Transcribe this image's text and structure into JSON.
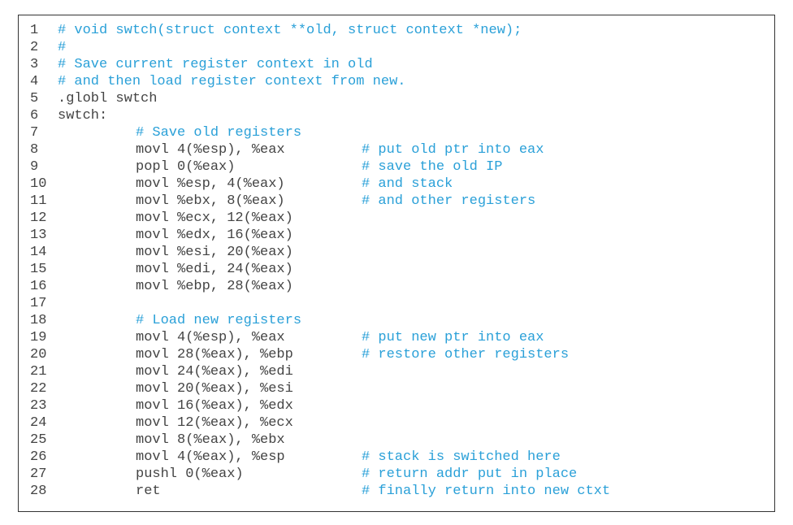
{
  "colors": {
    "comment": "#2aa0d8",
    "text": "#444444",
    "border": "#333333"
  },
  "lines": [
    {
      "n": "1",
      "parts": [
        {
          "cls": "code-comment",
          "t": "# void swtch(struct context **old, struct context *new);"
        }
      ]
    },
    {
      "n": "2",
      "parts": [
        {
          "cls": "code-comment",
          "t": "#"
        }
      ]
    },
    {
      "n": "3",
      "parts": [
        {
          "cls": "code-comment",
          "t": "# Save current register context in old"
        }
      ]
    },
    {
      "n": "4",
      "parts": [
        {
          "cls": "code-comment",
          "t": "# and then load register context from new."
        }
      ]
    },
    {
      "n": "5",
      "parts": [
        {
          "cls": "code-text",
          "t": ".globl swtch"
        }
      ]
    },
    {
      "n": "6",
      "parts": [
        {
          "cls": "code-text",
          "t": "swtch:"
        }
      ]
    },
    {
      "n": "7",
      "indent": true,
      "parts": [
        {
          "cls": "code-comment",
          "t": "# Save old registers"
        }
      ]
    },
    {
      "n": "8",
      "indent": true,
      "instr": "movl 4(%esp), %eax",
      "tail": {
        "cls": "code-comment",
        "t": "# put old ptr into eax"
      }
    },
    {
      "n": "9",
      "indent": true,
      "instr": "popl 0(%eax)",
      "tail": {
        "cls": "code-comment",
        "t": "# save the old IP"
      }
    },
    {
      "n": "10",
      "indent": true,
      "instr": "movl %esp, 4(%eax)",
      "tail": {
        "cls": "code-comment",
        "t": "# and stack"
      }
    },
    {
      "n": "11",
      "indent": true,
      "instr": "movl %ebx, 8(%eax)",
      "tail": {
        "cls": "code-comment",
        "t": "# and other registers"
      }
    },
    {
      "n": "12",
      "indent": true,
      "instr": "movl %ecx, 12(%eax)"
    },
    {
      "n": "13",
      "indent": true,
      "instr": "movl %edx, 16(%eax)"
    },
    {
      "n": "14",
      "indent": true,
      "instr": "movl %esi, 20(%eax)"
    },
    {
      "n": "15",
      "indent": true,
      "instr": "movl %edi, 24(%eax)"
    },
    {
      "n": "16",
      "indent": true,
      "instr": "movl %ebp, 28(%eax)"
    },
    {
      "n": "17",
      "parts": [
        {
          "cls": "code-text",
          "t": ""
        }
      ]
    },
    {
      "n": "18",
      "indent": true,
      "parts": [
        {
          "cls": "code-comment",
          "t": "# Load new registers"
        }
      ]
    },
    {
      "n": "19",
      "indent": true,
      "instr": "movl 4(%esp), %eax",
      "tail": {
        "cls": "code-comment",
        "t": "# put new ptr into eax"
      }
    },
    {
      "n": "20",
      "indent": true,
      "instr": "movl 28(%eax), %ebp",
      "tail": {
        "cls": "code-comment",
        "t": "# restore other registers"
      }
    },
    {
      "n": "21",
      "indent": true,
      "instr": "movl 24(%eax), %edi"
    },
    {
      "n": "22",
      "indent": true,
      "instr": "movl 20(%eax), %esi"
    },
    {
      "n": "23",
      "indent": true,
      "instr": "movl 16(%eax), %edx"
    },
    {
      "n": "24",
      "indent": true,
      "instr": "movl 12(%eax), %ecx"
    },
    {
      "n": "25",
      "indent": true,
      "instr": "movl 8(%eax), %ebx"
    },
    {
      "n": "26",
      "indent": true,
      "instr": "movl 4(%eax), %esp",
      "tail": {
        "cls": "code-comment",
        "t": "# stack is switched here"
      }
    },
    {
      "n": "27",
      "indent": true,
      "instr": "pushl 0(%eax)",
      "tail": {
        "cls": "code-comment",
        "t": "# return addr put in place"
      }
    },
    {
      "n": "28",
      "indent": true,
      "instr": "ret",
      "tail": {
        "cls": "code-comment",
        "t": "# finally return into new ctxt"
      }
    }
  ]
}
